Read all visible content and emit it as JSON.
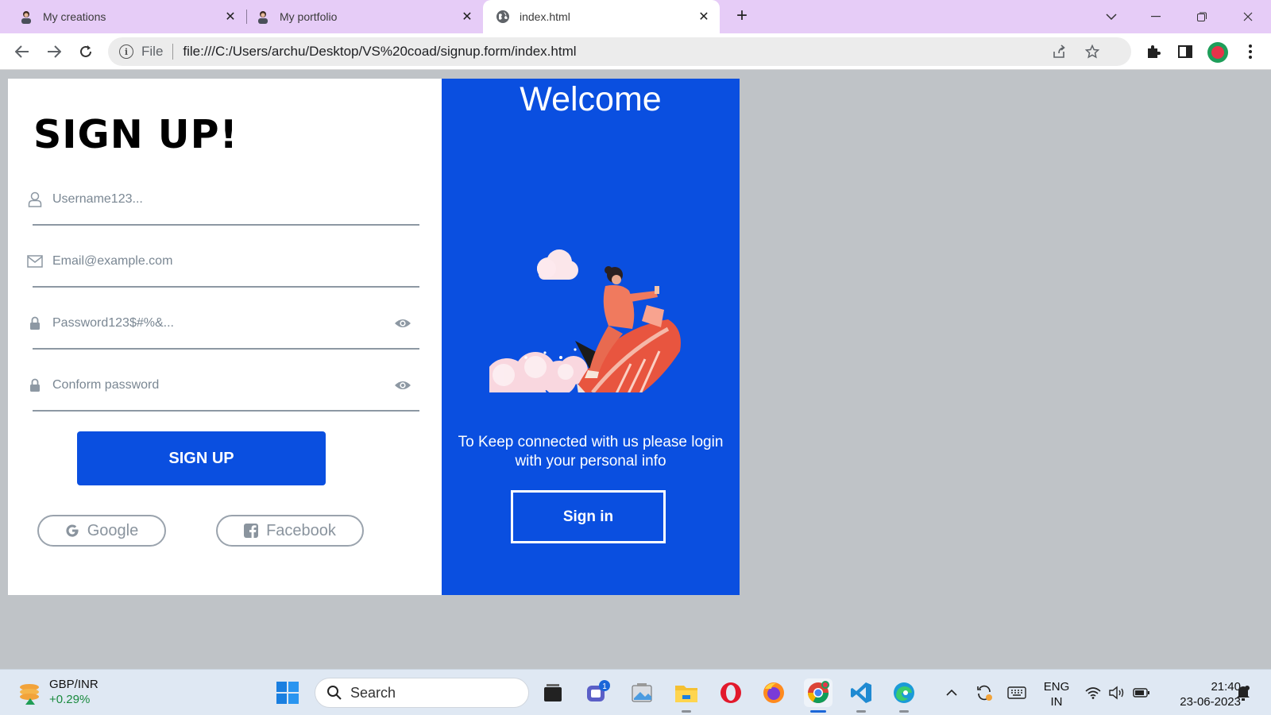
{
  "browser": {
    "tabs": [
      {
        "title": "My creations",
        "favicon": "avatar-icon",
        "active": false
      },
      {
        "title": "My portfolio",
        "favicon": "avatar-icon",
        "active": false
      },
      {
        "title": "index.html",
        "favicon": "globe-icon",
        "active": true
      }
    ],
    "address": {
      "scheme_label": "File",
      "url": "file:///C:/Users/archu/Desktop/VS%20coad/signup.form/index.html"
    }
  },
  "form": {
    "title": "SIGN UP!",
    "fields": [
      {
        "placeholder": "Username123...",
        "icon": "user-icon",
        "type": "text"
      },
      {
        "placeholder": "Email@example.com",
        "icon": "mail-icon",
        "type": "email"
      },
      {
        "placeholder": "Password123$#%&...",
        "icon": "lock-icon",
        "type": "password",
        "toggle": "eye-icon"
      },
      {
        "placeholder": "Conform password",
        "icon": "lock-icon",
        "type": "password",
        "toggle": "eye-icon"
      }
    ],
    "submit_label": "SIGN UP",
    "social": [
      {
        "label": "Google",
        "icon": "google-icon"
      },
      {
        "label": "Facebook",
        "icon": "facebook-icon"
      }
    ]
  },
  "welcome": {
    "title": "Welcome",
    "illustration": "rocket-rider-illustration",
    "message": "To Keep connected with us please login with your personal info",
    "signin_label": "Sign in"
  },
  "taskbar": {
    "widget": {
      "title": "GBP/INR",
      "change": "+0.29%"
    },
    "search_label": "Search",
    "chat_badge": "1",
    "language": {
      "line1": "ENG",
      "line2": "IN"
    },
    "time": "21:40",
    "date": "23-06-2023"
  },
  "colors": {
    "accent": "#0a4fe0",
    "tabbar": "#e6ccf7",
    "page_bg": "#bfc3c7",
    "input_line": "#8d98a3"
  }
}
